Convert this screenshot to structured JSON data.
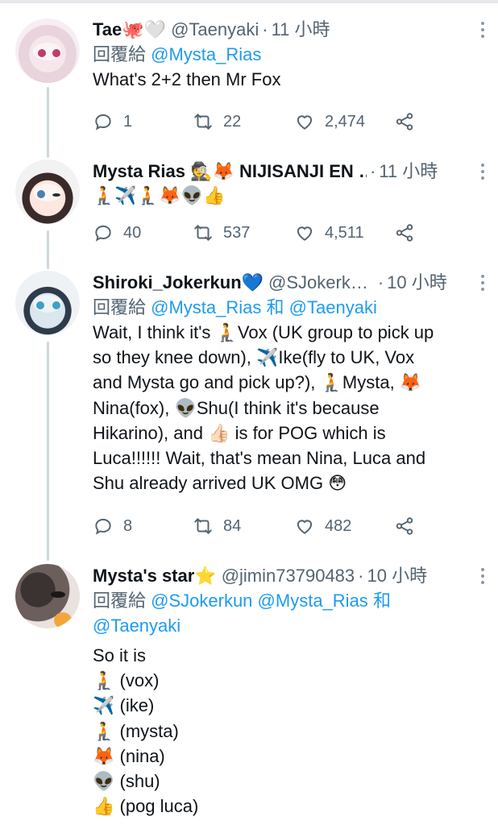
{
  "tweets": [
    {
      "name": "Tae🐙🤍",
      "handle": "@Taenyaki",
      "time": "11 小時",
      "reply_prefix": "回覆給",
      "reply_mentions": [
        "@Mysta_Rias"
      ],
      "lines": [
        "What's 2+2 then Mr Fox"
      ],
      "replies": "1",
      "retweets": "22",
      "likes": "2,474"
    },
    {
      "name": "Mysta Rias 🕵️🦊 NIJISANJI EN …",
      "handle": "",
      "time": "11 小時",
      "lines": [
        "🧎✈️🧎🦊👽👍"
      ],
      "replies": "40",
      "retweets": "537",
      "likes": "4,511"
    },
    {
      "name": "Shiroki_Jokerkun💙",
      "handle": "@SJokerk…",
      "time": "10 小時",
      "reply_prefix": "回覆給",
      "reply_mentions": [
        "@Mysta_Rias",
        "和",
        "@Taenyaki"
      ],
      "lines": [
        "Wait, I think it's 🧎Vox (UK group to pick up",
        "so they knee down), ✈️Ike(fly to UK, Vox",
        "and Mysta go and pick up?), 🧎Mysta, 🦊",
        "Nina(fox), 👽Shu(I think it's because",
        "Hikarino), and 👍🏻 is for POG which is",
        "Luca!!!!!! Wait, that's mean Nina, Luca and",
        "Shu already arrived UK OMG 😳"
      ],
      "replies": "8",
      "retweets": "84",
      "likes": "482"
    },
    {
      "name": "Mysta's star⭐",
      "handle": "@jimin73790483",
      "time": "10 小時",
      "reply_prefix": "回覆給",
      "reply_line1": [
        "@SJokerkun",
        "@Mysta_Rias",
        "和"
      ],
      "reply_line2": "@Taenyaki",
      "lines": [
        "So it is",
        "🧎 (vox)",
        "✈️ (ike)",
        "🧎 (mysta)",
        "🦊 (nina)",
        "👽 (shu)",
        "👍 (pog luca)"
      ]
    }
  ],
  "icons": {
    "reply": "reply-icon",
    "retweet": "retweet-icon",
    "like": "like-icon",
    "share": "share-icon",
    "more": "more-icon"
  },
  "colors": {
    "text": "#0f1419",
    "secondary": "#536471",
    "link": "#1d9bf0",
    "thread_line": "#cfd9de"
  }
}
